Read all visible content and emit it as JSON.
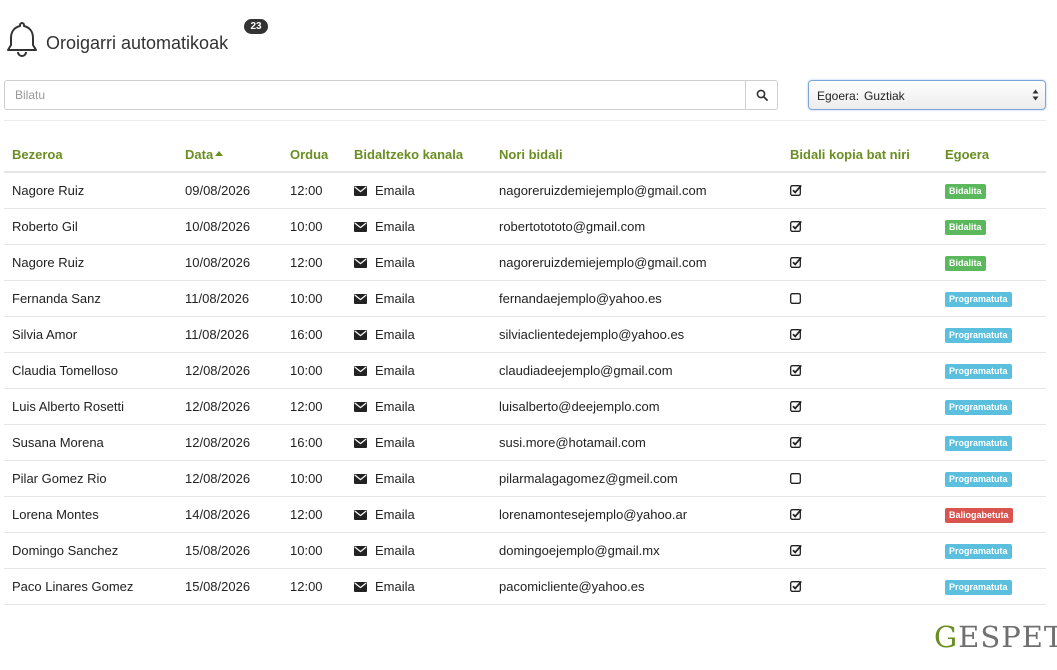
{
  "header": {
    "title": "Oroigarri automatikoak",
    "count": "23",
    "icon": "bell-icon"
  },
  "search": {
    "placeholder": "Bilatu",
    "value": "",
    "icon": "search-icon"
  },
  "filter": {
    "label": "Egoera:",
    "value": "Guztiak"
  },
  "table": {
    "columns": {
      "client": "Bezeroa",
      "date": "Data",
      "time": "Ordua",
      "channel": "Bidaltzeko kanala",
      "recipient": "Nori bidali",
      "copy": "Bidali kopia bat niri",
      "status": "Egoera"
    },
    "rows": [
      {
        "client": "Nagore Ruiz",
        "date": "09/08/2026",
        "time": "12:00",
        "channel": "Emaila",
        "recipient": "nagoreruizdemiejemplo@gmail.com",
        "copy": true,
        "status": "Bidalita",
        "status_color": "#5cb85c"
      },
      {
        "client": "Roberto Gil",
        "date": "10/08/2026",
        "time": "10:00",
        "channel": "Emaila",
        "recipient": "robertotototo@gmail.com",
        "copy": true,
        "status": "Bidalita",
        "status_color": "#5cb85c"
      },
      {
        "client": "Nagore Ruiz",
        "date": "10/08/2026",
        "time": "12:00",
        "channel": "Emaila",
        "recipient": "nagoreruizdemiejemplo@gmail.com",
        "copy": true,
        "status": "Bidalita",
        "status_color": "#5cb85c"
      },
      {
        "client": "Fernanda Sanz",
        "date": "11/08/2026",
        "time": "10:00",
        "channel": "Emaila",
        "recipient": "fernandaejemplo@yahoo.es",
        "copy": false,
        "status": "Programatuta",
        "status_color": "#5bc0de"
      },
      {
        "client": "Silvia Amor",
        "date": "11/08/2026",
        "time": "16:00",
        "channel": "Emaila",
        "recipient": "silviaclientedejemplo@yahoo.es",
        "copy": true,
        "status": "Programatuta",
        "status_color": "#5bc0de"
      },
      {
        "client": "Claudia Tomelloso",
        "date": "12/08/2026",
        "time": "10:00",
        "channel": "Emaila",
        "recipient": "claudiadeejemplo@gmail.com",
        "copy": true,
        "status": "Programatuta",
        "status_color": "#5bc0de"
      },
      {
        "client": "Luis Alberto Rosetti",
        "date": "12/08/2026",
        "time": "12:00",
        "channel": "Emaila",
        "recipient": "luisalberto@deejemplo.com",
        "copy": true,
        "status": "Programatuta",
        "status_color": "#5bc0de"
      },
      {
        "client": "Susana Morena",
        "date": "12/08/2026",
        "time": "16:00",
        "channel": "Emaila",
        "recipient": "susi.more@hotamail.com",
        "copy": true,
        "status": "Programatuta",
        "status_color": "#5bc0de"
      },
      {
        "client": "Pilar Gomez Rio",
        "date": "12/08/2026",
        "time": "10:00",
        "channel": "Emaila",
        "recipient": "pilarmalagagomez@gmeil.com",
        "copy": false,
        "status": "Programatuta",
        "status_color": "#5bc0de"
      },
      {
        "client": "Lorena Montes",
        "date": "14/08/2026",
        "time": "12:00",
        "channel": "Emaila",
        "recipient": "lorenamontesejemplo@yahoo.ar",
        "copy": true,
        "status": "Baliogabetuta",
        "status_color": "#d9534f"
      },
      {
        "client": "Domingo Sanchez",
        "date": "15/08/2026",
        "time": "10:00",
        "channel": "Emaila",
        "recipient": "domingoejemplo@gmail.mx",
        "copy": true,
        "status": "Programatuta",
        "status_color": "#5bc0de"
      },
      {
        "client": "Paco Linares Gomez",
        "date": "15/08/2026",
        "time": "12:00",
        "channel": "Emaila",
        "recipient": "pacomicliente@yahoo.es",
        "copy": true,
        "status": "Programatuta",
        "status_color": "#5bc0de"
      }
    ]
  },
  "brand": {
    "logo_prefix": "G",
    "logo_rest": "ESPET",
    "accent": "#6b8e23"
  }
}
